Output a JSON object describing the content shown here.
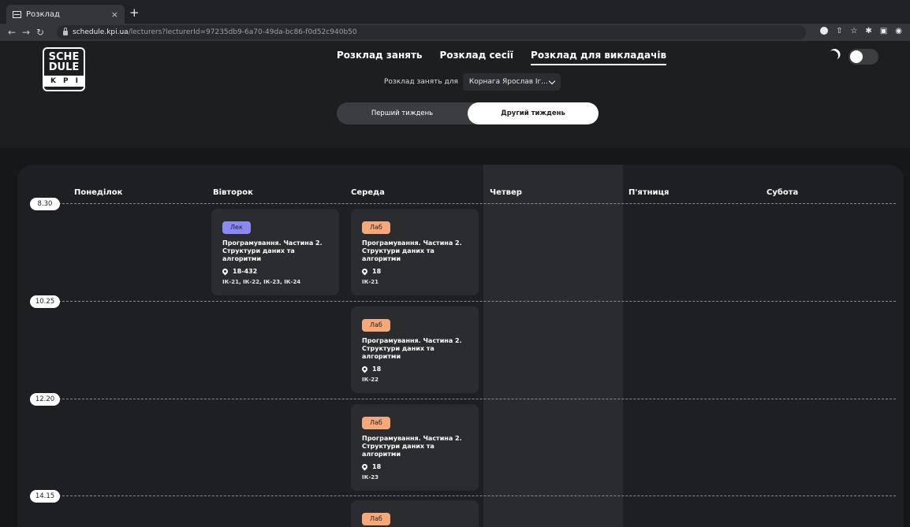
{
  "browser": {
    "tab_title": "Розклад",
    "tab_close": "×",
    "new_tab": "+",
    "url_host": "schedule.kpi.ua",
    "url_path": "/lecturers?lecturerId=97235db9-6a70-49da-bc86-f0d52c940b50"
  },
  "logo": {
    "line1": "SCHE",
    "line2": "DULE",
    "line3": "KPI"
  },
  "nav": {
    "classes": "Розклад занять",
    "session": "Розклад сесії",
    "lecturers": "Розклад для викладачів"
  },
  "lecturer": {
    "label": "Розклад занять для",
    "selected": "Корнага Ярослав Іг..."
  },
  "weeks": {
    "first": "Перший тиждень",
    "second": "Другий тиждень"
  },
  "days": [
    "Понеділок",
    "Вівторок",
    "Середа",
    "Четвер",
    "П'ятниця",
    "Субота"
  ],
  "times": [
    "8.30",
    "10.25",
    "12.20",
    "14.15"
  ],
  "cards": [
    {
      "type": "Лек",
      "title": "Програмування. Частина 2. Структури даних та алгоритми",
      "room": "18-432",
      "groups": "ІК-21, ІК-22, ІК-23, ІК-24"
    },
    {
      "type": "Лаб",
      "title": "Програмування. Частина 2. Структури даних та алгоритми",
      "room": "18",
      "groups": "ІК-21"
    },
    {
      "type": "Лаб",
      "title": "Програмування. Частина 2. Структури даних та алгоритми",
      "room": "18",
      "groups": "ІК-22"
    },
    {
      "type": "Лаб",
      "title": "Програмування. Частина 2. Структури даних та алгоритми",
      "room": "18",
      "groups": "ІК-23"
    },
    {
      "type": "Лаб"
    }
  ],
  "colors": {
    "lecture_badge": "#8b89f5",
    "lab_badge": "#f7a879",
    "background": "#161718"
  }
}
